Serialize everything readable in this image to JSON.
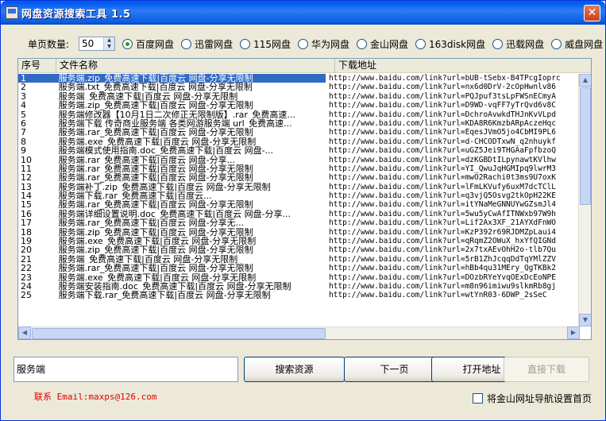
{
  "window": {
    "title": "网盘资源搜索工具 1.5",
    "close": "✕"
  },
  "options": {
    "count_label": "单页数量:",
    "count_value": "50",
    "engines": [
      "百度网盘",
      "迅雷网盘",
      "115网盘",
      "华为网盘",
      "金山网盘",
      "163disk网盘",
      "迅载网盘",
      "威盘网盘"
    ],
    "selected_engine": "百度网盘"
  },
  "table": {
    "headers": [
      "序号",
      "文件名称",
      "下载地址"
    ],
    "rows": [
      [
        "1",
        "服务端.zip_免费高速下载|百度云 网盘-分享无限制",
        "http://www.baidu.com/link?url=bUB-tSebx-B4TPcgIoprc"
      ],
      [
        "2",
        "服务端.txt_免费高速下载|百度云 网盘-分享无限制",
        "http://www.baidu.com/link?url=nx6d0DrV-2cOpHwnlv86"
      ],
      [
        "3",
        "服务端_免费高速下载|百度云 网盘-分享无限制",
        "http://www.baidu.com/link?url=PQJpuf3tsLpFWSnECmyA"
      ],
      [
        "4",
        "服务端.zip_免费高速下载|百度云 网盘-分享无限制",
        "http://www.baidu.com/link?url=D9WD-vqFF7yTrQvd6v8C"
      ],
      [
        "5",
        "服务端修改器【10月1日二次修正无限制版】.rar_免费高速...",
        "http://www.baidu.com/link?url=DchroAvwkdTHJnKvVLpd"
      ],
      [
        "6",
        "服务端下载 传奇商业服务端 各类网游服务端 url_免费高速...",
        "http://www.baidu.com/link?url=KDA8R6KmzbARpAczeHqc"
      ],
      [
        "7",
        "服务端.rar_免费高速下载|百度云 网盘-分享无限制",
        "http://www.baidu.com/link?url=EqesJVmO5jo4CbMI9PL6"
      ],
      [
        "8",
        "服务端.exe_免费高速下载|百度云 网盘-分享无限制",
        "http://www.baidu.com/link?url=d-CHCODTxwN_q2nhuykf"
      ],
      [
        "9",
        "服务端模式使用指南.doc_免费高速下载|百度云 网盘-...",
        "http://www.baidu.com/link?url=uGZ5Jei9THGAaFpfbzoQ"
      ],
      [
        "10",
        "服务端.rar_免费高速下载|百度云 网盘-分享...",
        "http://www.baidu.com/link?url=dzKGBDtILpynawtKVlhw"
      ],
      [
        "11",
        "服务端.rar_免费高速下载|百度云 网盘-分享无限制",
        "http://www.baidu.com/link?url=YI_QwuJqHGMIpq9lwrM3"
      ],
      [
        "12",
        "服务端.rar_免费高速下载|百度云 网盘-分享无限制",
        "http://www.baidu.com/link?url=mwO2Rachi0t3ms9U7oxK"
      ],
      [
        "13",
        "服务端补丁.zip_免费高速下载|百度云 网盘-分享无限制",
        "http://www.baidu.com/link?url=lFmLKVufy6uxM7dcTClL"
      ],
      [
        "14",
        "服务端下载.rar_免费高速下载|百度云...",
        "http://www.baidu.com/link?url=q3vjQ5Osvg2tkOpH22KE"
      ],
      [
        "15",
        "服务端.rar_免费高速下载|百度云 网盘-分享无限制",
        "http://www.baidu.com/link?url=itYNaMeGNNUYwGZsmJl4"
      ],
      [
        "16",
        "服务端详细设置说明.doc_免费高速下载|百度云 网盘-分享...",
        "http://www.baidu.com/link?url=5wu5yCwAfITNWxb97W9h"
      ],
      [
        "17",
        "服务端.rar_免费高速下载|百度云 网盘-分享无...",
        "http://www.baidu.com/link?url=Lif2Ax3XF_21AYXdFnWO"
      ],
      [
        "18",
        "服务端.zip_免费高速下载|百度云 网盘-分享无限制",
        "http://www.baidu.com/link?url=KzP392r69RJDMZpLaui4"
      ],
      [
        "19",
        "服务端.exe_免费高速下载|百度云 网盘-分享无限制",
        "http://www.baidu.com/link?url=qRqmZ2OWuX_hxYfQIGNd"
      ],
      [
        "20",
        "服务端.zip_免费高速下载|百度云 网盘-分享无限制",
        "http://www.baidu.com/link?url=2x7txAEvOhH2o-tlb7Qu"
      ],
      [
        "21",
        "服务端_免费高速下载|百度云 网盘-分享无限制",
        "http://www.baidu.com/link?url=5rB1ZhJcqqDdTqYMlZZV"
      ],
      [
        "22",
        "服务端.rar_免费高速下载|百度云 网盘-分享无限制",
        "http://www.baidu.com/link?url=hBb4qu31MEry_QgTKBk2"
      ],
      [
        "23",
        "服务端.exe_免费高速下载|百度云 网盘-分享无限制",
        "http://www.baidu.com/link?url=DOzbRYeYvqOExDcEoNPE"
      ],
      [
        "24",
        "服务端安装指南.doc_免费高速下载|百度云 网盘-分享无限制",
        "http://www.baidu.com/link?url=m8n96imiwu9slkmRb8gj"
      ],
      [
        "25",
        "服务端下载.rar_免费高速下载|百度云 网盘-分享无限制",
        "http://www.baidu.com/link?url=wtYnR03-6DWP_2sSeC"
      ]
    ],
    "selected_row": "1"
  },
  "search": {
    "value": "服务端"
  },
  "buttons": {
    "search": "搜索资源",
    "next": "下一页",
    "open": "打开地址",
    "download": "直接下载"
  },
  "footer": {
    "contact": "联系 Email:maxps@126.com",
    "checkbox_label": "将金山网址导航设置首页"
  }
}
